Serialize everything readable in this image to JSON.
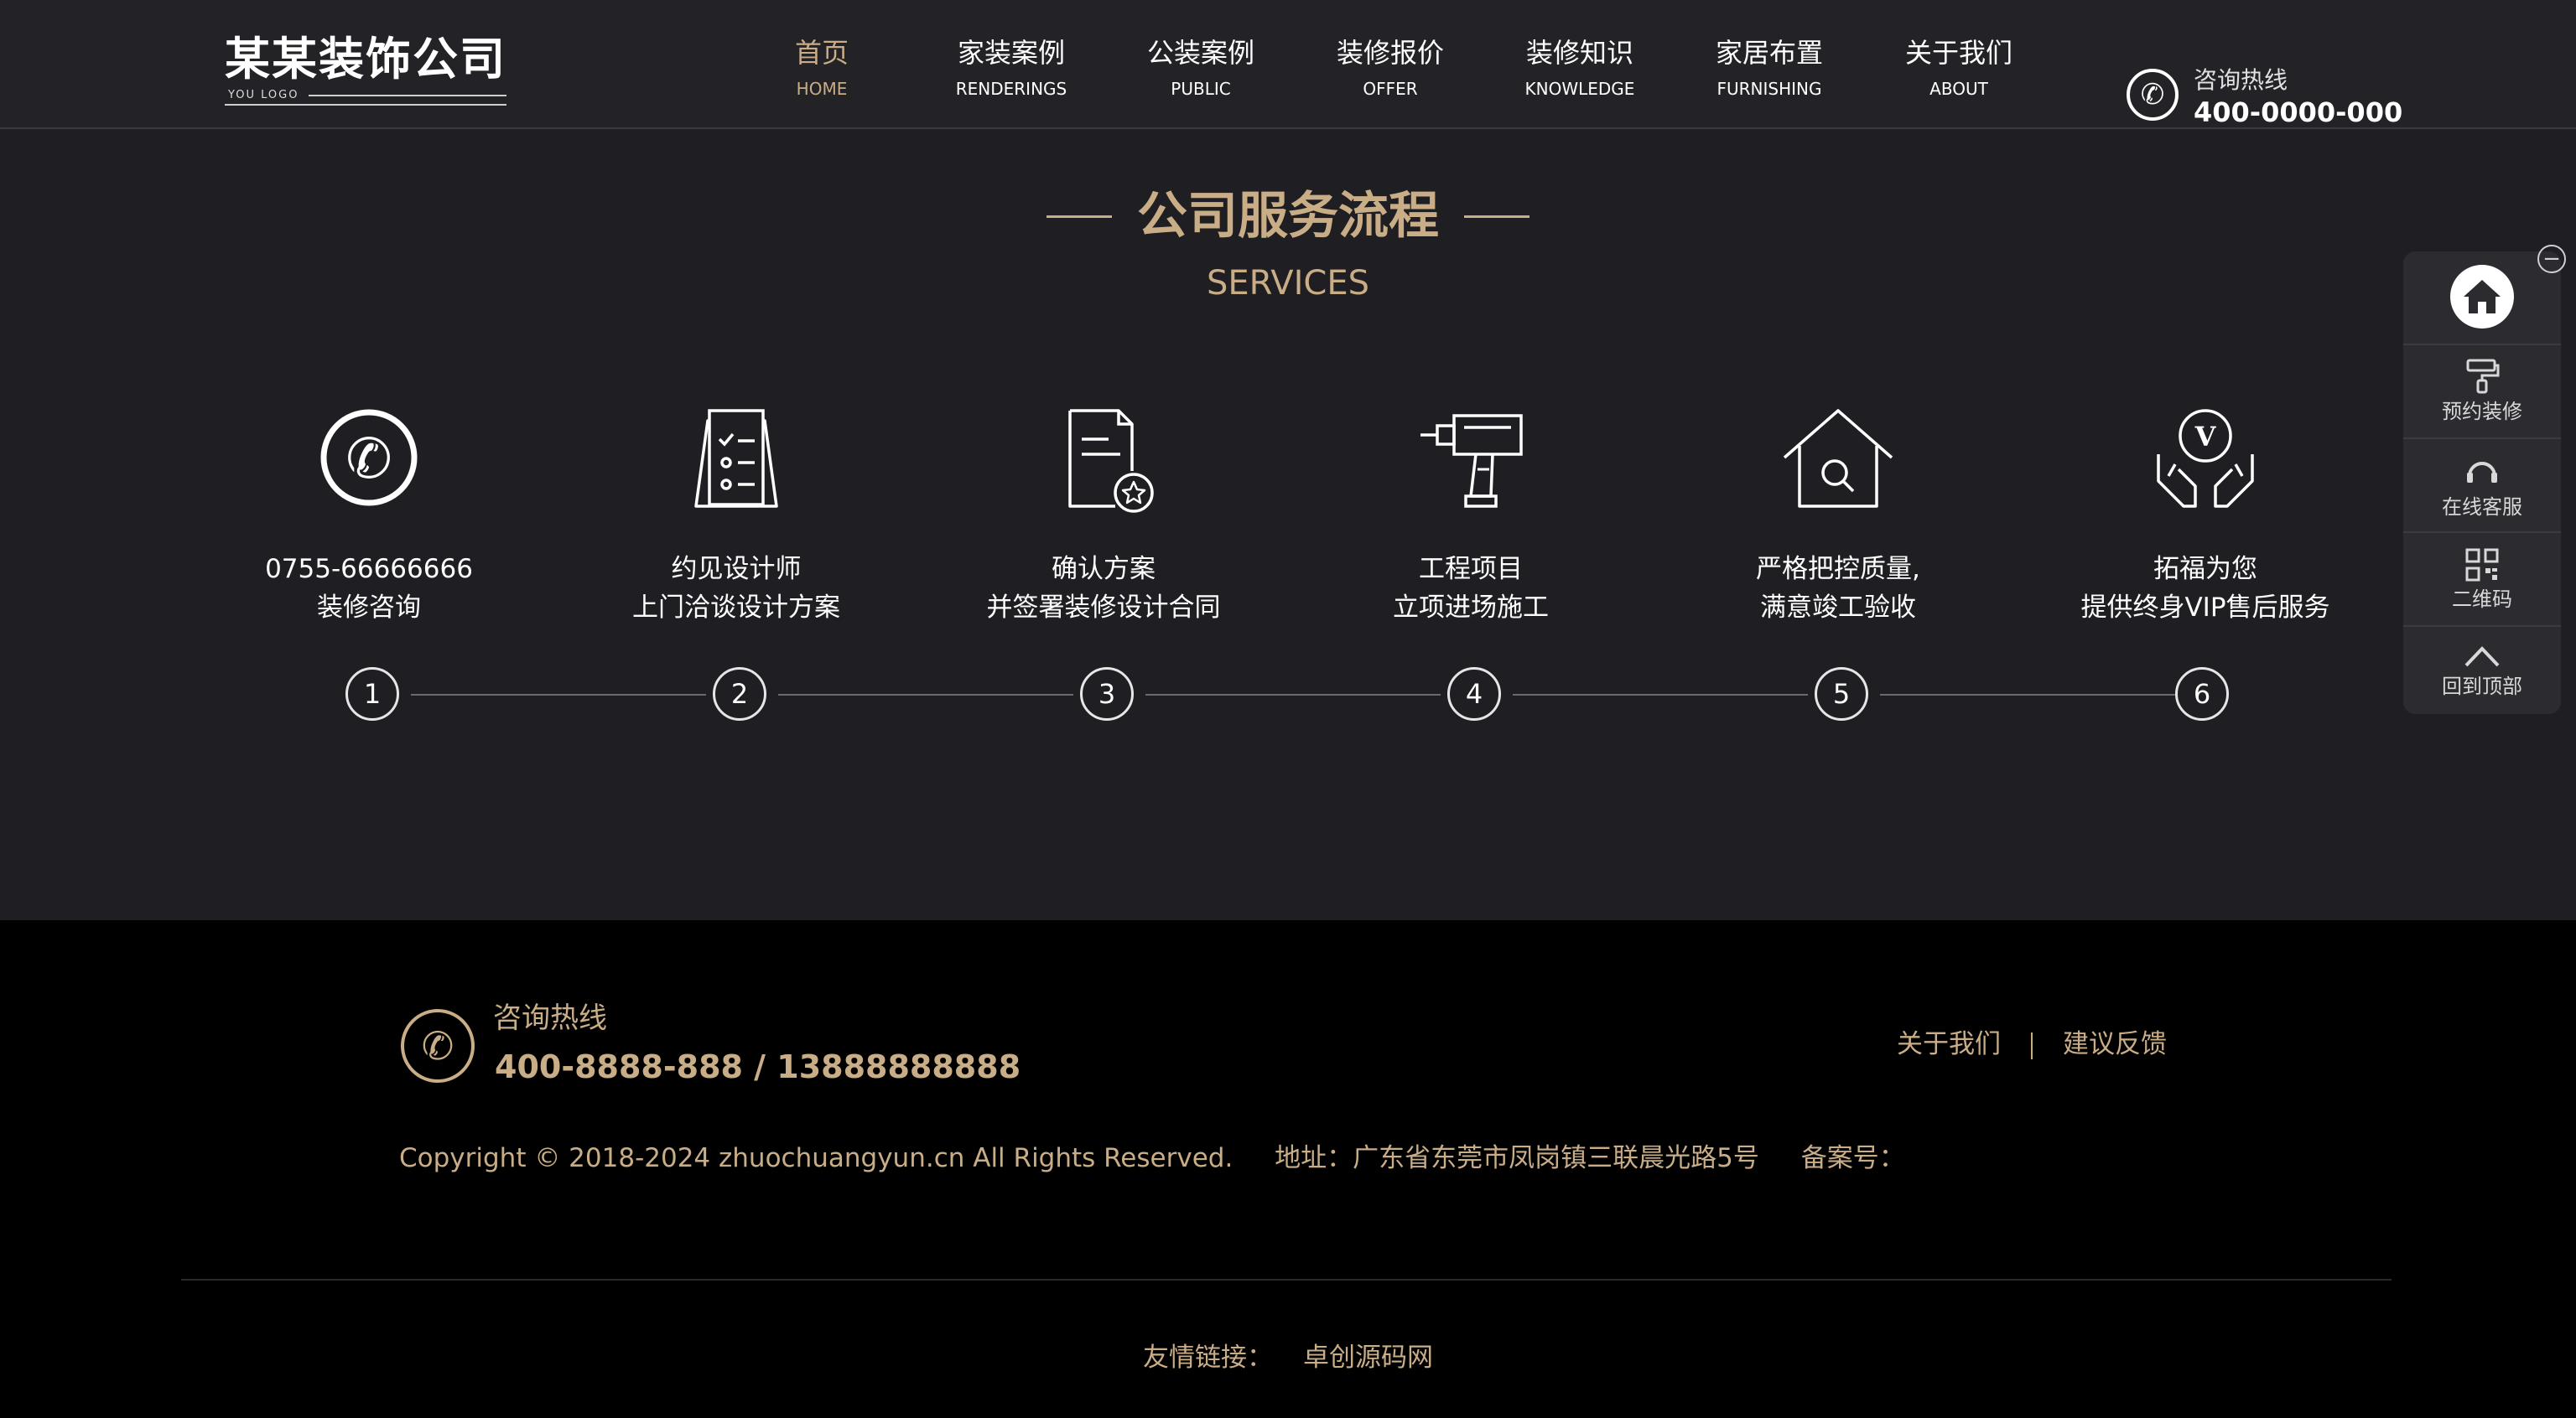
{
  "header": {
    "logo_text": "某某装饰公司",
    "logo_sub": "YOU LOGO",
    "nav": [
      {
        "cn": "首页",
        "en": "HOME",
        "active": true
      },
      {
        "cn": "家装案例",
        "en": "RENDERINGS"
      },
      {
        "cn": "公装案例",
        "en": "PUBLIC"
      },
      {
        "cn": "装修报价",
        "en": "OFFER"
      },
      {
        "cn": "装修知识",
        "en": "KNOWLEDGE"
      },
      {
        "cn": "家居布置",
        "en": "FURNISHING"
      },
      {
        "cn": "关于我们",
        "en": "ABOUT"
      }
    ],
    "hotline_label": "咨询热线",
    "hotline_number": "400-0000-000"
  },
  "services": {
    "title": "公司服务流程",
    "subtitle": "SERVICES",
    "steps": [
      {
        "line1": "0755-66666666",
        "line2": "装修咨询",
        "icon": "phone-icon",
        "num": "1"
      },
      {
        "line1": "约见设计师",
        "line2": "上门洽谈设计方案",
        "icon": "checklist-icon",
        "num": "2"
      },
      {
        "line1": "确认方案",
        "line2": "并签署装修设计合同",
        "icon": "contract-icon",
        "num": "3"
      },
      {
        "line1": "工程项目",
        "line2": "立项进场施工",
        "icon": "drill-icon",
        "num": "4"
      },
      {
        "line1": "严格把控质量,",
        "line2": "满意竣工验收",
        "icon": "house-search-icon",
        "num": "5"
      },
      {
        "line1": "拓福为您",
        "line2": "提供终身VIP售后服务",
        "icon": "vip-hands-icon",
        "num": "6"
      }
    ]
  },
  "side": {
    "close": "−",
    "items": [
      {
        "label": "预约装修",
        "icon": "paint-roller-icon"
      },
      {
        "label": "在线客服",
        "icon": "headset-icon"
      },
      {
        "label": "二维码",
        "icon": "qr-code-icon"
      },
      {
        "label": "回到顶部",
        "icon": "chevron-up-icon"
      }
    ]
  },
  "footer": {
    "hotline_label": "咨询热线",
    "hotline_number": "400-8888-888 / 13888888888",
    "link_about": "关于我们",
    "link_feedback": "建议反馈",
    "copyright": "Copyright © 2018-2024 zhuochuangyun.cn All Rights Reserved.",
    "address": "地址：广东省东莞市凤岗镇三联晨光路5号",
    "icp": "备案号：",
    "friends_label": "友情链接：",
    "friends": [
      "卓创源码网"
    ]
  },
  "colors": {
    "accent": "#c8ad87",
    "background": "#1f1e22",
    "header": "#232226",
    "footer": "#000000"
  }
}
